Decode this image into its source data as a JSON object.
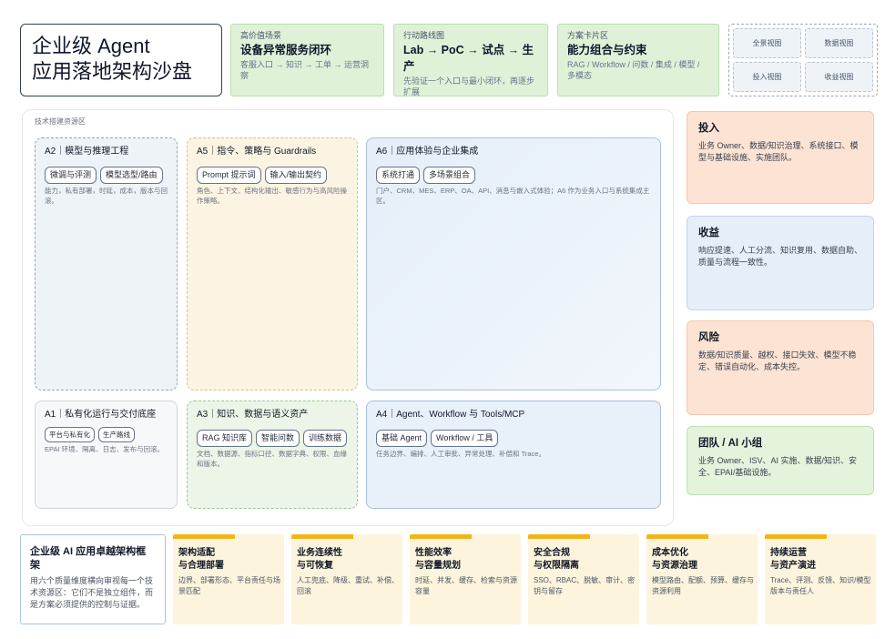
{
  "title": {
    "line1": "企业级 Agent",
    "line2": "应用落地架构沙盘"
  },
  "header_cards": [
    {
      "kicker": "高价值场景",
      "heading": "设备异常服务闭环",
      "sub": "客服入口 → 知识 → 工单 → 运营洞察"
    },
    {
      "kicker": "行动路线图",
      "heading": "Lab → PoC → 试点 → 生产",
      "sub": "先验证一个入口与最小闭环，再逐步扩展"
    },
    {
      "kicker": "方案卡片区",
      "heading": "能力组合与约束",
      "sub": "RAG / Workflow / 问数 / 集成 / 模型 / 多模态"
    }
  ],
  "views": [
    "全景视图",
    "数据视图",
    "投入视图",
    "收益视图"
  ],
  "pool_label": "技术搭建资源区",
  "modules": {
    "a2": {
      "title": "A2｜模型与推理工程",
      "tags": [
        "微调与评测",
        "模型选型/路由"
      ],
      "desc": "能力，私有部署，时延，成本，版本与回滚。"
    },
    "a5": {
      "title": "A5｜指令、策略与 Guardrails",
      "tags": [
        "Prompt 提示词",
        "输入/输出契约"
      ],
      "desc": "角色、上下文、结构化输出、敏感行为与高风险操作策略。"
    },
    "a6": {
      "title": "A6｜应用体验与企业集成",
      "tags": [
        "系统打通",
        "多场景组合"
      ],
      "desc": "门户、CRM、MES、ERP、OA、API、消息与嵌入式体验；A6 作为业务入口与系统集成主区。"
    },
    "a1": {
      "title": "A1｜私有化运行与交付底座",
      "tags": [
        "平台与私有化",
        "生产路线"
      ],
      "desc": "EPAI 环境、隔离、日志、发布与回滚。"
    },
    "a3": {
      "title": "A3｜知识、数据与语义资产",
      "tags": [
        "RAG 知识库",
        "智能问数",
        "训练数据"
      ],
      "desc": "文档、数据源、指标口径、数据字典、权限、血缘和版本。"
    },
    "a4": {
      "title": "A4｜Agent、Workflow 与 Tools/MCP",
      "tags": [
        "基础 Agent",
        "Workflow / 工具"
      ],
      "desc": "任务边界、编排、人工审批、异常处理、补偿和 Trace。"
    }
  },
  "side_cards": [
    {
      "title": "投入",
      "desc": "业务 Owner、数据/知识治理、系统接口、模型与基础设施、实施团队。"
    },
    {
      "title": "收益",
      "desc": "响应提速、人工分流、知识复用、数据自助、质量与流程一致性。"
    },
    {
      "title": "风险",
      "desc": "数据/知识质量、越权、接口失效、模型不稳定、错误自动化、成本失控。"
    },
    {
      "title": "团队 / AI 小组",
      "desc": "业务 Owner、ISV、AI 实施、数据/知识、安全、EPAI/基础设施。"
    }
  ],
  "framework": {
    "title": "企业级 AI 应用卓越架构框架",
    "desc": "用六个质量维度横向审视每一个技术资源区：它们不是独立组件，而是方案必须提供的控制与证据。"
  },
  "pillars": [
    {
      "title": "架构适配\n与合理部署",
      "desc": "边界、部署形态、平台责任与场景匹配"
    },
    {
      "title": "业务连续性\n与可恢复",
      "desc": "人工兜底、降级、重试、补偿、回滚"
    },
    {
      "title": "性能效率\n与容量规划",
      "desc": "时延、并发、缓存、检索与资源容量"
    },
    {
      "title": "安全合规\n与权限隔离",
      "desc": "SSO、RBAC、脱敏、审计、密钥与留存"
    },
    {
      "title": "成本优化\n与资源治理",
      "desc": "模型路由、配额、预算、缓存与资源利用"
    },
    {
      "title": "持续运营\n与资产演进",
      "desc": "Trace、评测、反馈、知识/模型版本与责任人"
    }
  ]
}
